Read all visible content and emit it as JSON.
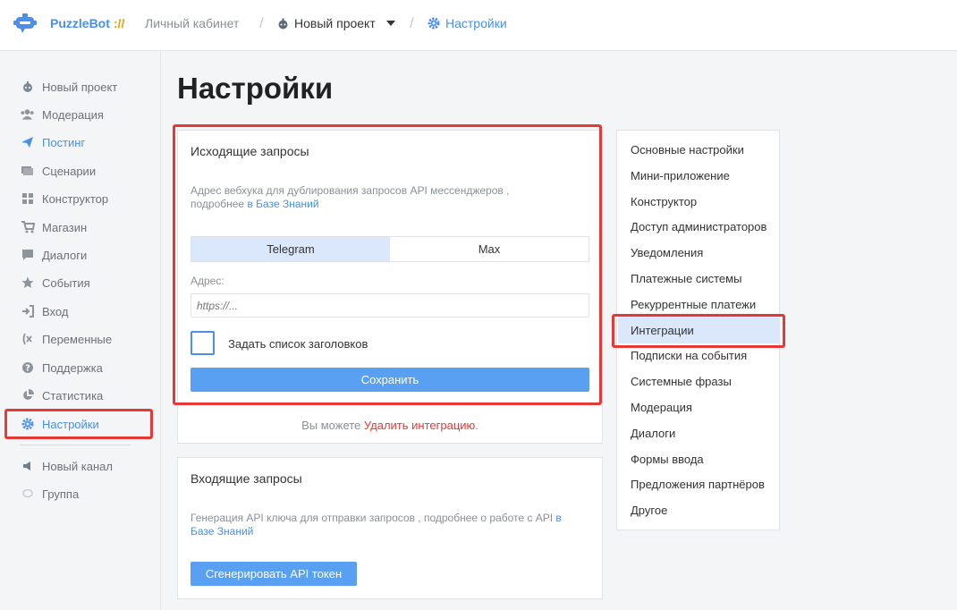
{
  "header": {
    "brand": "PuzzleBot",
    "brand_sep": "://",
    "cabinet": "Личный кабинет",
    "project": "Новый проект",
    "settings": "Настройки"
  },
  "sidebar": {
    "items": [
      {
        "label": "Новый проект",
        "icon": "bot-icon"
      },
      {
        "label": "Модерация",
        "icon": "users-icon"
      },
      {
        "label": "Постинг",
        "icon": "paper-plane-icon"
      },
      {
        "label": "Сценарии",
        "icon": "layers-icon"
      },
      {
        "label": "Конструктор",
        "icon": "grid-icon"
      },
      {
        "label": "Магазин",
        "icon": "cart-icon"
      },
      {
        "label": "Диалоги",
        "icon": "chat-icon"
      },
      {
        "label": "События",
        "icon": "star-icon"
      },
      {
        "label": "Вход",
        "icon": "sign-in-icon"
      },
      {
        "label": "Переменные",
        "icon": "variable-icon"
      },
      {
        "label": "Поддержка",
        "icon": "question-icon"
      },
      {
        "label": "Статистика",
        "icon": "pie-chart-icon"
      },
      {
        "label": "Настройки",
        "icon": "gear-icon"
      }
    ],
    "channels": [
      {
        "label": "Новый канал",
        "icon": "megaphone-icon"
      },
      {
        "label": "Группа",
        "icon": "chat-bubble-icon"
      }
    ]
  },
  "page": {
    "title": "Настройки"
  },
  "outgoing": {
    "title": "Исходящие запросы",
    "desc_line1": "Адрес вебхука для дублирования запросов API мессенджеров ,",
    "desc_line2_prefix": "подробнее ",
    "desc_link": "в Базе Знаний",
    "tabs": [
      "Telegram",
      "Max"
    ],
    "address_label": "Адрес:",
    "address_placeholder": "https://...",
    "headers_checkbox_label": "Задать список заголовков",
    "save_label": "Сохранить"
  },
  "note": {
    "prefix": "Вы можете ",
    "danger_link": "Удалить интеграцию",
    "suffix": "."
  },
  "incoming": {
    "title": "Входящие запросы",
    "desc_line1_prefix": "Генерация API ключа для отправки запросов , подробнее о работе с API ",
    "desc_link_1": "в",
    "desc_link_2": "Базе Знаний",
    "generate_label": "Сгенерировать API токен"
  },
  "settings_menu": {
    "items": [
      "Основные настройки",
      "Мини-приложение",
      "Конструктор",
      "Доступ администраторов",
      "Уведомления",
      "Платежные системы",
      "Рекуррентные платежи",
      "Интеграции",
      "Подписки на события",
      "Системные фразы",
      "Модерация",
      "Диалоги",
      "Формы ввода",
      "Предложения партнёров",
      "Другое"
    ],
    "active": "Интеграции"
  },
  "colors": {
    "accent": "#4a8fe8",
    "highlight": "#e53935",
    "active_bg": "#dbe8fb"
  }
}
